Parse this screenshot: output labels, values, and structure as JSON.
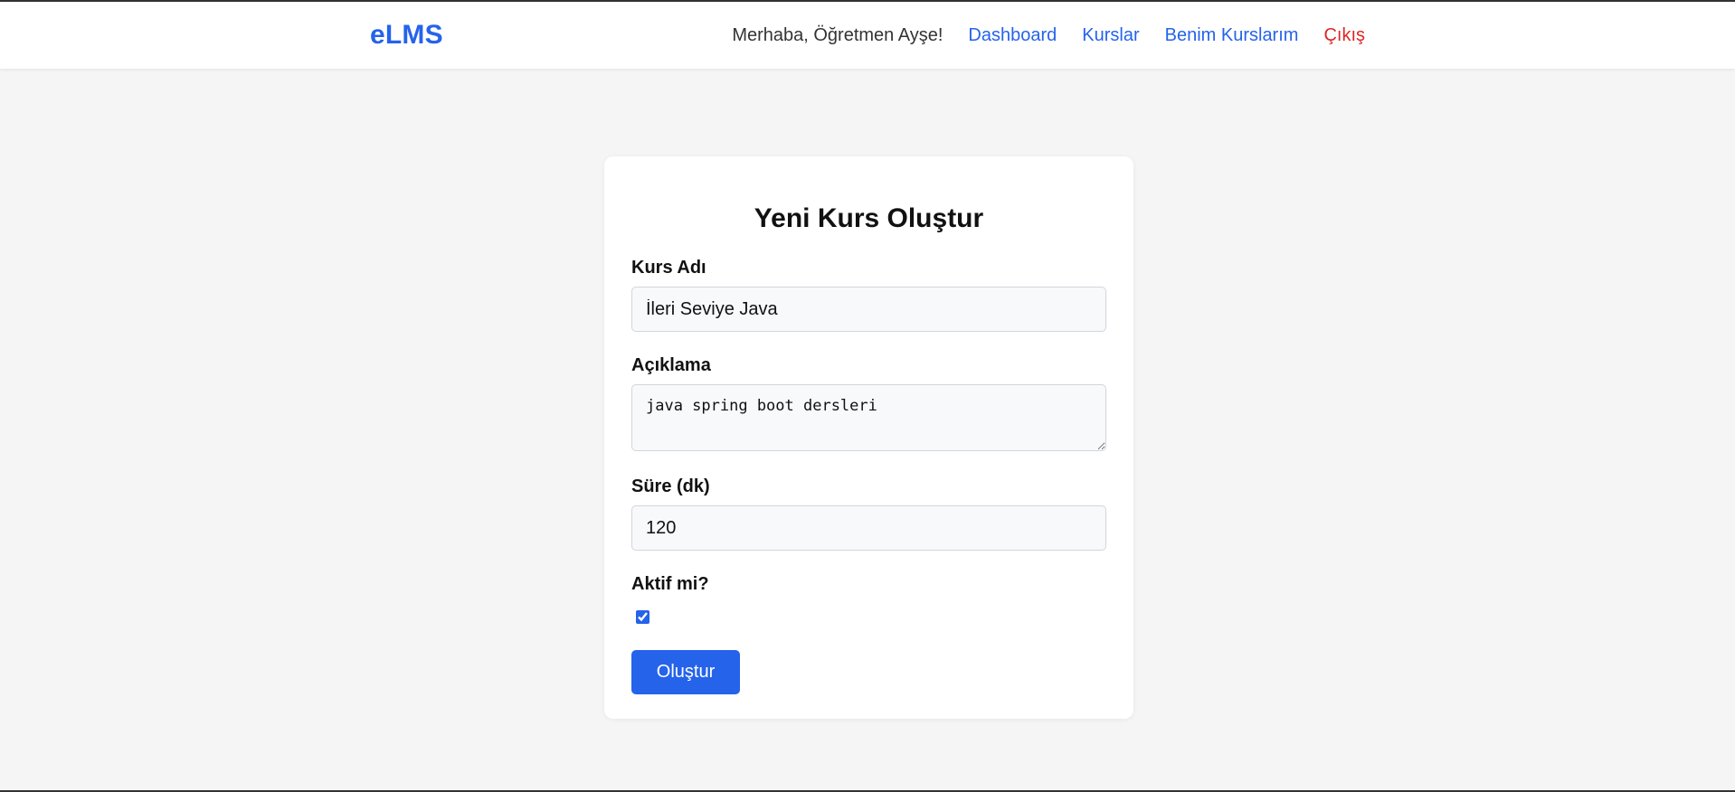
{
  "app": {
    "brand": "eLMS"
  },
  "nav": {
    "greeting": "Merhaba, Öğretmen Ayşe!",
    "links": [
      {
        "label": "Dashboard"
      },
      {
        "label": "Kurslar"
      },
      {
        "label": "Benim Kurslarım"
      },
      {
        "label": "Çıkış"
      }
    ]
  },
  "form": {
    "title": "Yeni Kurs Oluştur",
    "course_name": {
      "label": "Kurs Adı",
      "value": "İleri Seviye Java"
    },
    "description": {
      "label": "Açıklama",
      "value": "java spring boot dersleri"
    },
    "duration": {
      "label": "Süre (dk)",
      "value": "120"
    },
    "active": {
      "label": "Aktif mi?",
      "checked": true
    },
    "submit_label": "Oluştur"
  },
  "colors": {
    "accent": "#2563eb",
    "danger": "#dc2626",
    "background": "#f5f5f5"
  }
}
